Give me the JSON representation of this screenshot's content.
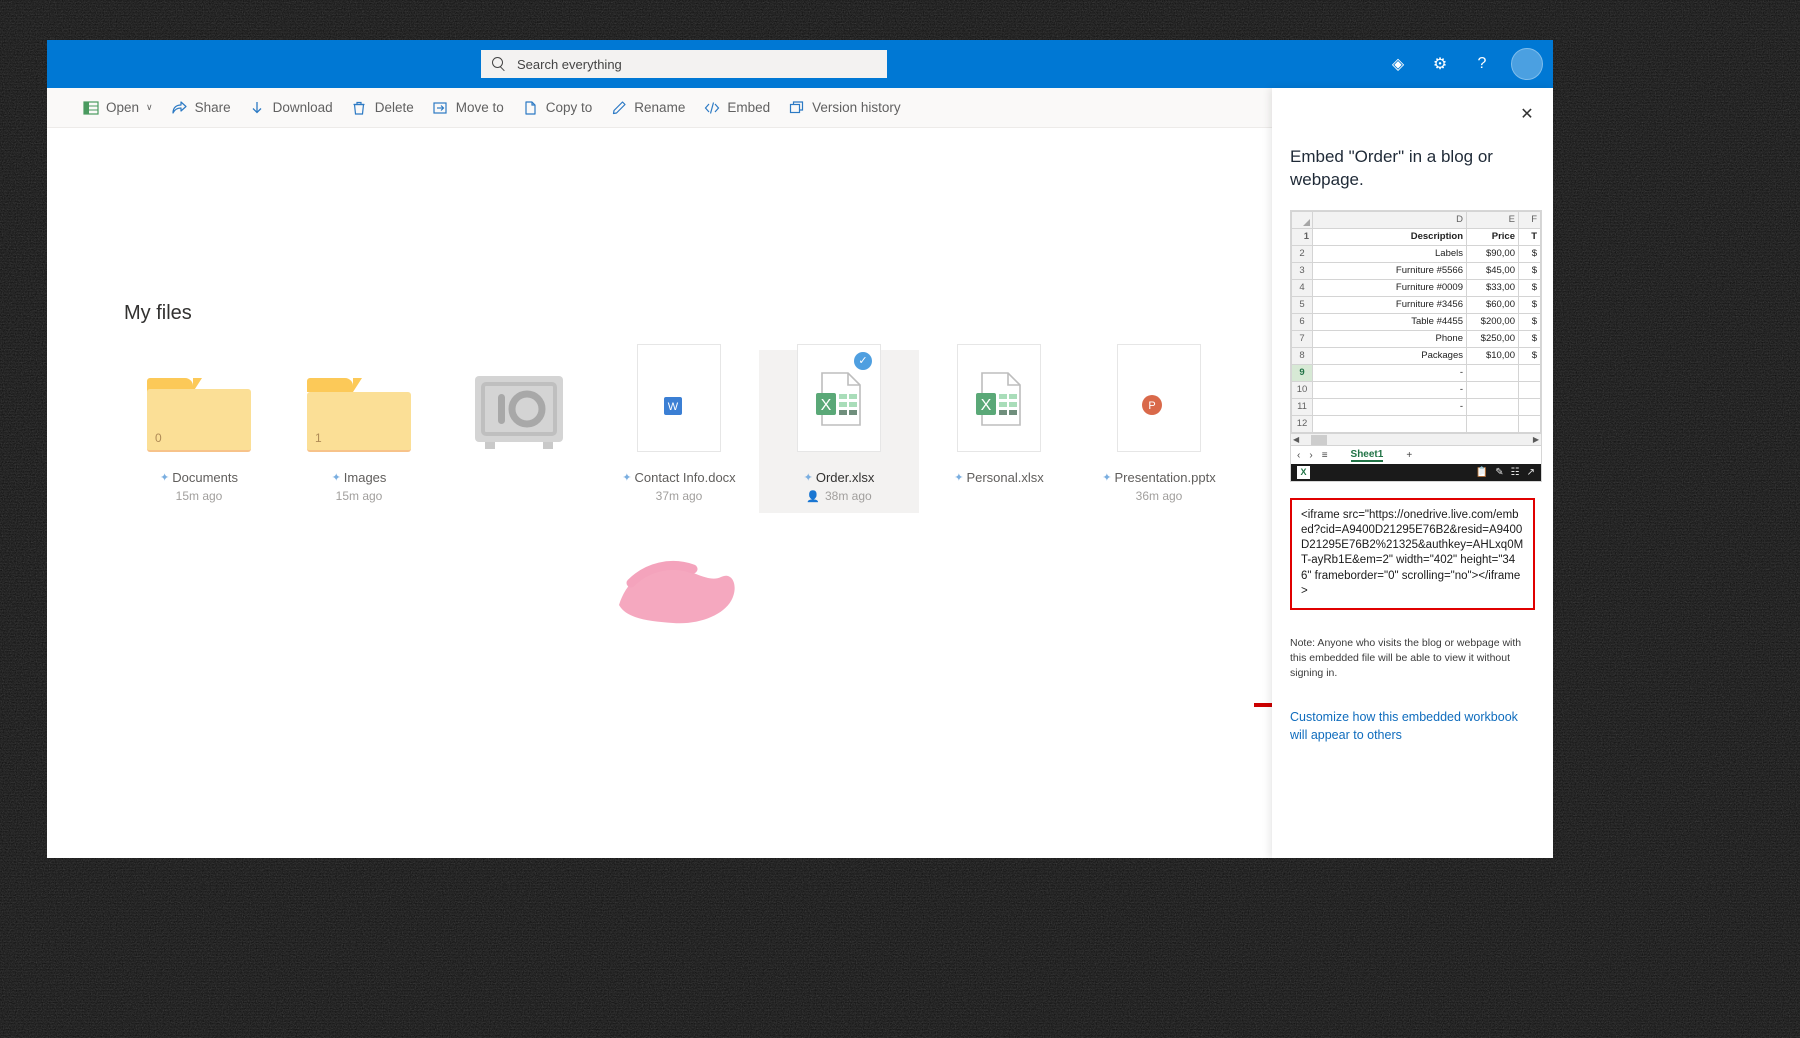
{
  "suite": {
    "search_placeholder": "Search everything",
    "icons": [
      {
        "name": "diamond-icon",
        "glyph": "◈"
      },
      {
        "name": "settings-gear-icon",
        "glyph": "⚙"
      },
      {
        "name": "help-icon",
        "glyph": "?"
      }
    ],
    "avatar_label": ""
  },
  "toolbar": {
    "items": [
      {
        "label": "Open",
        "icon": "excel-open-icon",
        "caret": "∨"
      },
      {
        "label": "Share",
        "icon": "share-icon",
        "caret": ""
      },
      {
        "label": "Download",
        "icon": "download-arrow-icon",
        "caret": ""
      },
      {
        "label": "Delete",
        "icon": "trash-icon",
        "caret": ""
      },
      {
        "label": "Move to",
        "icon": "move-to-icon",
        "caret": ""
      },
      {
        "label": "Copy to",
        "icon": "copy-icon",
        "caret": ""
      },
      {
        "label": "Rename",
        "icon": "pencil-icon",
        "caret": ""
      },
      {
        "label": "Embed",
        "icon": "code-brackets-icon",
        "caret": ""
      },
      {
        "label": "Version history",
        "icon": "version-history-icon",
        "caret": ""
      }
    ]
  },
  "main": {
    "page_title": "My files",
    "tiles": [
      {
        "kind": "folder",
        "name": "Documents",
        "meta": "15m ago",
        "count": "0",
        "open": false,
        "selected": false,
        "shared": false
      },
      {
        "kind": "folder",
        "name": "Images",
        "meta": "15m ago",
        "count": "1",
        "open": true,
        "selected": false,
        "shared": false
      },
      {
        "kind": "safe",
        "name": "",
        "meta": "",
        "count": "",
        "open": false,
        "selected": false,
        "shared": false
      },
      {
        "kind": "word",
        "name": "Contact Info.docx",
        "meta": "37m ago",
        "count": "",
        "open": false,
        "selected": false,
        "shared": false
      },
      {
        "kind": "excel",
        "name": "Order.xlsx",
        "meta": "38m ago",
        "count": "",
        "open": false,
        "selected": true,
        "shared": true
      },
      {
        "kind": "excel",
        "name": "Personal.xlsx",
        "meta": "",
        "count": "",
        "open": false,
        "selected": false,
        "shared": false
      },
      {
        "kind": "powerpoint",
        "name": "Presentation.pptx",
        "meta": "36m ago",
        "count": "",
        "open": false,
        "selected": false,
        "shared": false
      }
    ]
  },
  "panel": {
    "close_label": "✕",
    "title": "Embed \"Order\" in a blog or webpage.",
    "embed_code": "<iframe src=\"https://onedrive.live.com/embed?cid=A9400D21295E76B2&resid=A9400D21295E76B2%21325&authkey=AHLxq0MT-ayRb1E&em=2\" width=\"402\" height=\"346\" frameborder=\"0\" scrolling=\"no\"></iframe>",
    "note": "Note: Anyone who visits the blog or webpage with this embedded file will be able to view it without signing in.",
    "customize_link": "Customize how this embedded workbook will appear to others",
    "accent_red": "#e00000",
    "link_blue": "#0f6cbd"
  },
  "spreadsheet": {
    "column_headers": [
      "D",
      "E",
      "F"
    ],
    "rows": [
      {
        "n": "1",
        "desc": "Description",
        "price": "Price",
        "tot": "T",
        "header": true,
        "selected": false
      },
      {
        "n": "2",
        "desc": "Labels",
        "price": "$90,00",
        "tot": "$",
        "header": false,
        "selected": false
      },
      {
        "n": "3",
        "desc": "Furniture #5566",
        "price": "$45,00",
        "tot": "$",
        "header": false,
        "selected": false
      },
      {
        "n": "4",
        "desc": "Furniture #0009",
        "price": "$33,00",
        "tot": "$",
        "header": false,
        "selected": false
      },
      {
        "n": "5",
        "desc": "Furniture #3456",
        "price": "$60,00",
        "tot": "$",
        "header": false,
        "selected": false
      },
      {
        "n": "6",
        "desc": "Table #4455",
        "price": "$200,00",
        "tot": "$",
        "header": false,
        "selected": false
      },
      {
        "n": "7",
        "desc": "Phone",
        "price": "$250,00",
        "tot": "$",
        "header": false,
        "selected": false
      },
      {
        "n": "8",
        "desc": "Packages",
        "price": "$10,00",
        "tot": "$",
        "header": false,
        "selected": false
      },
      {
        "n": "9",
        "desc": "-",
        "price": "",
        "tot": "",
        "header": false,
        "selected": true
      },
      {
        "n": "10",
        "desc": "-",
        "price": "",
        "tot": "",
        "header": false,
        "selected": false
      },
      {
        "n": "11",
        "desc": "-",
        "price": "",
        "tot": "",
        "header": false,
        "selected": false
      },
      {
        "n": "12",
        "desc": "",
        "price": "",
        "tot": "",
        "header": false,
        "selected": false
      }
    ],
    "sheet_tab": "Sheet1",
    "add_sheet": "+",
    "nav_prev": "‹",
    "nav_next": "›",
    "nav_menu": "≡",
    "statusbar_logo": "X"
  }
}
